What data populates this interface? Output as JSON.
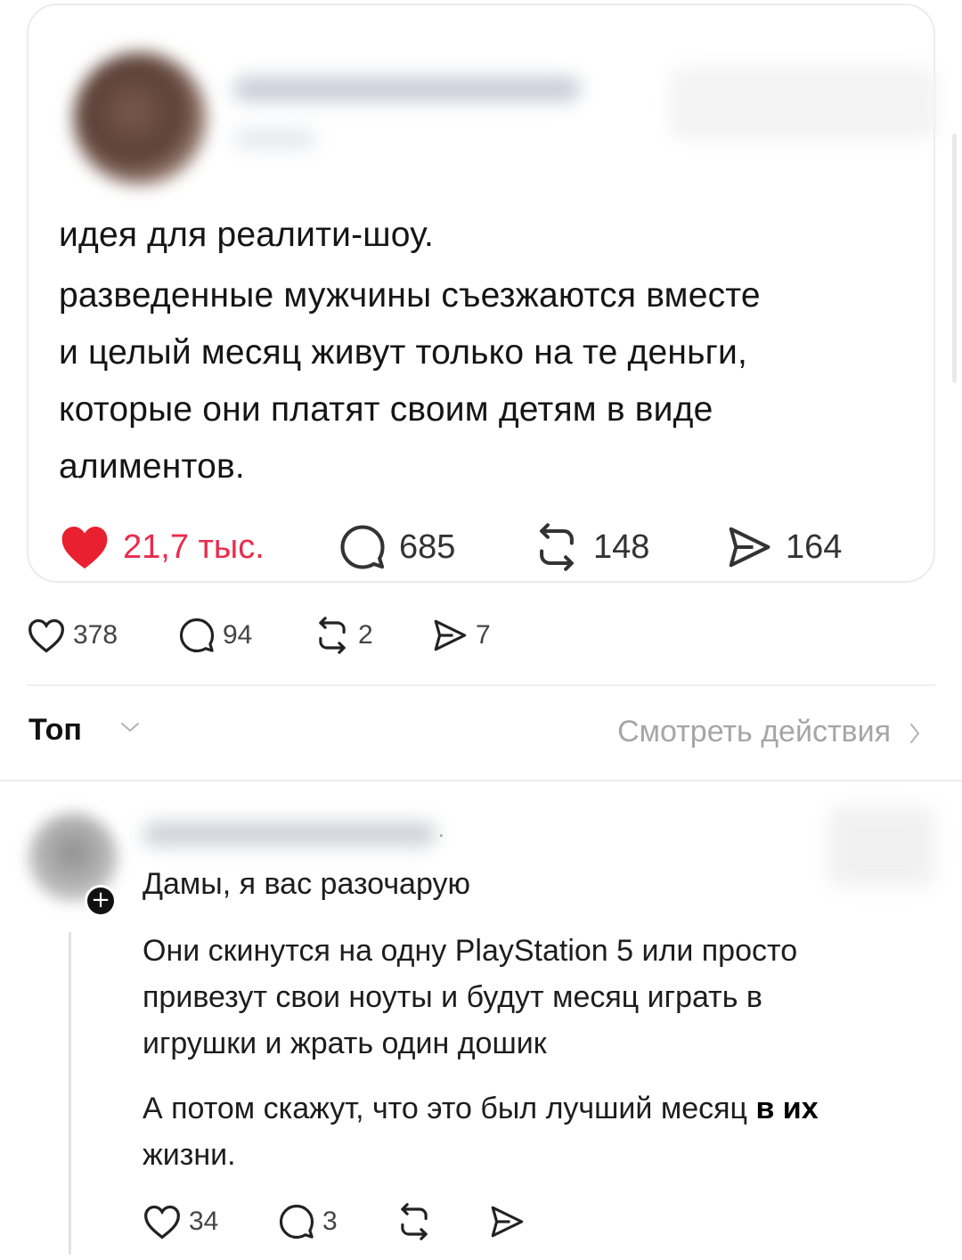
{
  "quoted_post": {
    "text_lines": [
      "идея для реалити-шоу.",
      "разведенные мужчины съезжаются вместе",
      "и целый месяц живут только на те деньги,",
      "которые они платят своим детям в виде",
      "алиментов."
    ],
    "stats": {
      "likes": "21,7 тыс.",
      "replies": "685",
      "reposts": "148",
      "shares": "164"
    },
    "liked": true,
    "like_color": "#e8202f"
  },
  "post_stats": {
    "likes": "378",
    "replies": "94",
    "reposts": "2",
    "shares": "7"
  },
  "sort": {
    "label": "Топ",
    "activity_link": "Смотреть действия"
  },
  "comment": {
    "heading": "Дамы, я вас разочарую",
    "paragraph1_lines": [
      "Они скинутся на одну PlayStation 5 или просто",
      "привезут свои ноуты и будут месяц играть в",
      "игрушки и жрать один дошик"
    ],
    "paragraph2_line1": "А потом скажут, что это был лучший месяц ",
    "paragraph2_emph": "в их",
    "paragraph2_line2": "жизни.",
    "stats": {
      "likes": "34",
      "replies": "3"
    }
  },
  "icons": {
    "like": "heart-icon",
    "reply": "comment-bubble-icon",
    "repost": "repost-icon",
    "share": "send-icon"
  }
}
